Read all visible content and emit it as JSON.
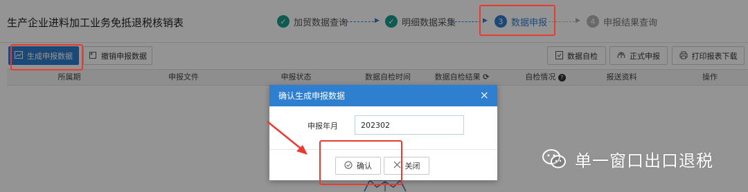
{
  "header": {
    "title": "生产企业进料加工业务免抵退税核销表",
    "steps": [
      {
        "label": "加贸数据查询",
        "state": "done",
        "marker": "✓"
      },
      {
        "label": "明细数据采集",
        "state": "done",
        "marker": "✓"
      },
      {
        "label": "数据申报",
        "state": "active",
        "marker": "3"
      },
      {
        "label": "申报结果查询",
        "state": "todo",
        "marker": "4"
      }
    ]
  },
  "toolbar": {
    "generate_label": "生成申报数据",
    "revoke_label": "撤销申报数据",
    "self_check_label": "数据自检",
    "formal_declare_label": "正式申报",
    "print_download_label": "打印报表下载"
  },
  "table": {
    "columns": [
      "所属期",
      "申报文件",
      "申报状态",
      "数据自检时间",
      "数据自检结果",
      "自检情况",
      "报送资料",
      "操作"
    ]
  },
  "modal": {
    "title": "确认生成申报数据",
    "field_label": "申报年月",
    "field_value": "202302",
    "confirm_label": "确认",
    "close_label": "关闭"
  },
  "watermark": {
    "text": "单一窗口出口退税"
  },
  "colors": {
    "primary": "#2e7fcf",
    "done": "#1a9d8c",
    "annotation_red": "#e83a30"
  }
}
